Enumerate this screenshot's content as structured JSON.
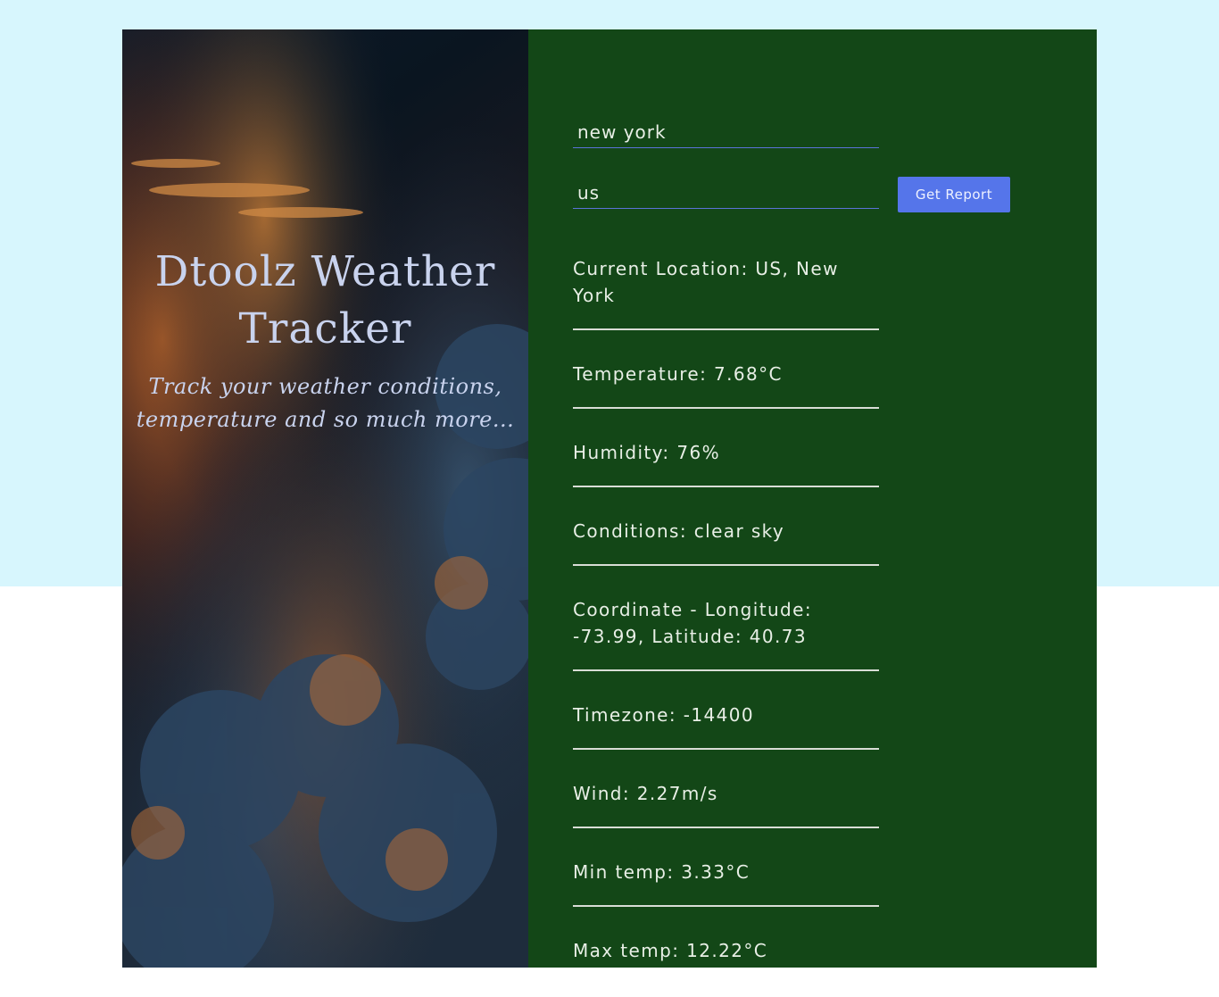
{
  "hero": {
    "title": "Dtoolz Weather Tracker",
    "subtitle": "Track your weather conditions, temperature and so much more..."
  },
  "form": {
    "city_value": "new york",
    "country_value": "us",
    "button_label": "Get Report"
  },
  "report": [
    "Current Location: US, New York",
    "Temperature: 7.68°C",
    "Humidity: 76%",
    "Conditions: clear sky",
    "Coordinate - Longitude: -73.99, Latitude: 40.73",
    "Timezone: -14400",
    "Wind: 2.27m/s",
    "Min temp: 3.33°C",
    "Max temp: 12.22°C"
  ],
  "colors": {
    "page_top": "#d7f6fd",
    "panel": "#134717",
    "button": "#5575ea",
    "hero_text": "#c9d3ee"
  }
}
